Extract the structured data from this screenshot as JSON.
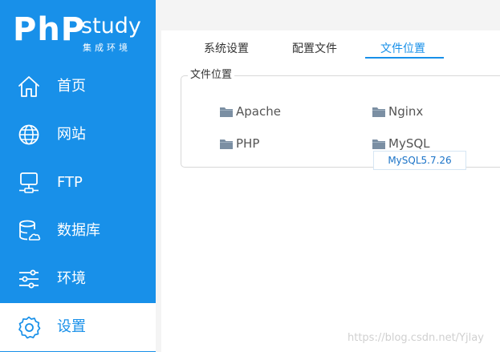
{
  "app": {
    "logo_php": "PhP",
    "logo_study": "study",
    "logo_sub": "集成环境"
  },
  "sidebar": {
    "items": [
      {
        "label": "首页",
        "icon": "home-icon"
      },
      {
        "label": "网站",
        "icon": "globe-icon"
      },
      {
        "label": "FTP",
        "icon": "server-icon"
      },
      {
        "label": "数据库",
        "icon": "database-icon"
      },
      {
        "label": "环境",
        "icon": "sliders-icon"
      },
      {
        "label": "设置",
        "icon": "gear-icon",
        "active": true
      }
    ]
  },
  "tabs": [
    {
      "label": "系统设置"
    },
    {
      "label": "配置文件"
    },
    {
      "label": "文件位置",
      "active": true
    }
  ],
  "file_location": {
    "title": "文件位置",
    "items": [
      {
        "label": "Apache",
        "icon": "folder-icon"
      },
      {
        "label": "Nginx",
        "icon": "folder-icon"
      },
      {
        "label": "PHP",
        "icon": "folder-icon"
      },
      {
        "label": "MySQL",
        "icon": "folder-icon"
      }
    ],
    "tooltip": "MySQL5.7.26"
  },
  "watermark": "https://blog.csdn.net/Yjlay",
  "colors": {
    "accent": "#1890e9",
    "sidebar_bg": "#1890e9",
    "content_bg": "#ffffff",
    "page_bg": "#f4f4f4",
    "folder": "#7b8fa3"
  }
}
